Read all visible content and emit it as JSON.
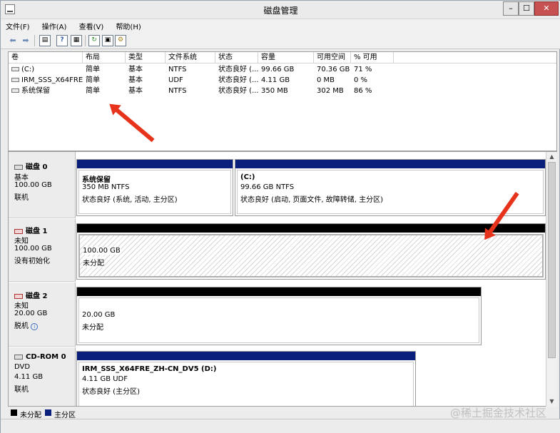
{
  "window": {
    "title": "磁盘管理",
    "min": "–",
    "max": "☐",
    "close": "✕"
  },
  "menu": [
    "文件(F)",
    "操作(A)",
    "查看(V)",
    "帮助(H)"
  ],
  "toolbar": [
    "back-icon",
    "forward-icon",
    "list-icon",
    "help-icon",
    "properties-icon",
    "refresh-icon",
    "rescan-icon",
    "settings-icon"
  ],
  "volumes": {
    "columns": [
      "卷",
      "布局",
      "类型",
      "文件系统",
      "状态",
      "容量",
      "可用空间",
      "% 可用"
    ],
    "rows": [
      [
        "(C:)",
        "简单",
        "基本",
        "NTFS",
        "状态良好 (...",
        "99.66 GB",
        "70.36 GB",
        "71 %"
      ],
      [
        "IRM_SSS_X64FRE...",
        "简单",
        "基本",
        "UDF",
        "状态良好 (...",
        "4.11 GB",
        "0 MB",
        "0 %"
      ],
      [
        "系统保留",
        "简单",
        "基本",
        "NTFS",
        "状态良好 (...",
        "350 MB",
        "302 MB",
        "86 %"
      ]
    ]
  },
  "disks": [
    {
      "name": "磁盘 0",
      "type": "基本",
      "size": "100.00 GB",
      "state": "联机",
      "parts": [
        {
          "title": "系统保留",
          "line1": "350 MB NTFS",
          "line2": "状态良好 (系统, 活动, 主分区)"
        },
        {
          "title": "(C:)",
          "line1": "99.66 GB NTFS",
          "line2": "状态良好 (启动, 页面文件, 故障转储, 主分区)"
        }
      ]
    },
    {
      "name": "磁盘 1",
      "type": "未知",
      "size": "100.00 GB",
      "state": "没有初始化",
      "parts": [
        {
          "line1": "100.00 GB",
          "line2": "未分配"
        }
      ]
    },
    {
      "name": "磁盘 2",
      "type": "未知",
      "size": "20.00 GB",
      "state": "脱机",
      "parts": [
        {
          "line1": "20.00 GB",
          "line2": "未分配"
        }
      ]
    },
    {
      "name": "CD-ROM 0",
      "type": "DVD",
      "size": "4.11 GB",
      "state": "联机",
      "parts": [
        {
          "title": "IRM_SSS_X64FRE_ZH-CN_DV5 (D:)",
          "line1": "4.11 GB UDF",
          "line2": "状态良好 (主分区)"
        }
      ]
    }
  ],
  "legend": {
    "unallocated": "未分配",
    "primary": "主分区"
  },
  "colors": {
    "primary": "#0a1e7c",
    "unallocated": "#000000",
    "arrow": "#e8331c"
  },
  "watermark": "@稀土掘金技术社区"
}
